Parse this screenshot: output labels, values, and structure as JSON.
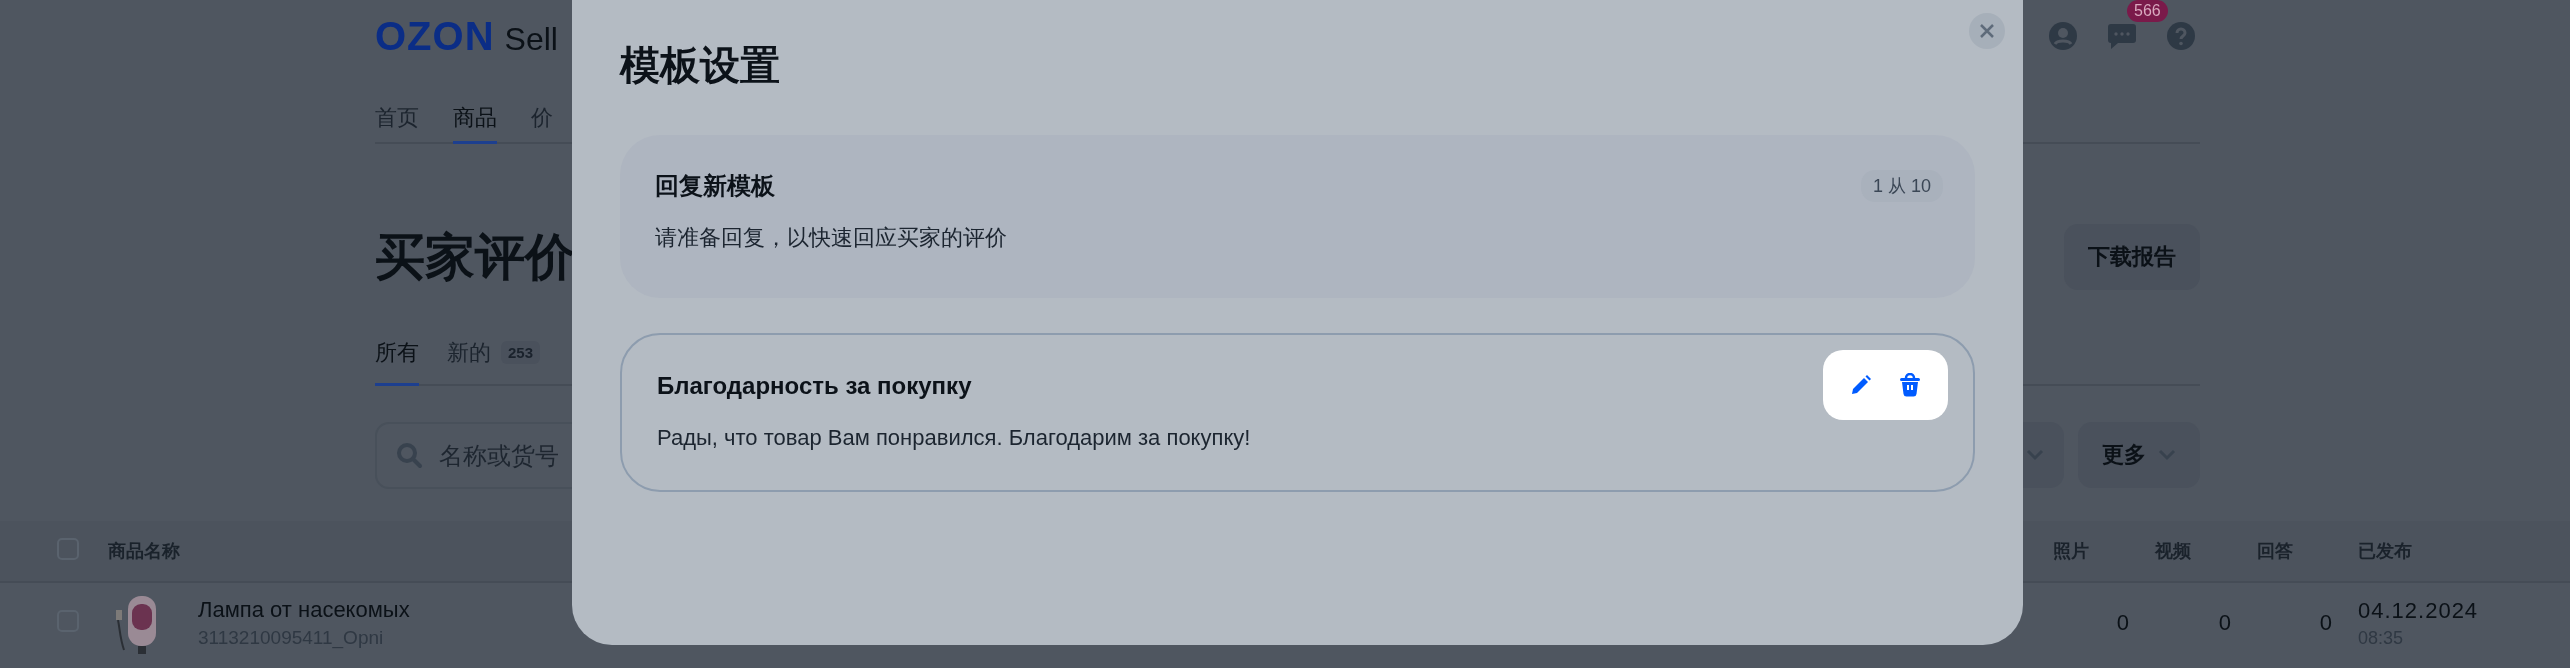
{
  "header": {
    "logo": "OZON",
    "logo_suffix": "Sell",
    "notifications_badge": "566"
  },
  "nav": [
    {
      "label": "首页",
      "selected": false
    },
    {
      "label": "商品",
      "selected": true
    },
    {
      "label": "价",
      "selected": false
    }
  ],
  "page_title": "买家评价",
  "download_button": "下载报告",
  "tabs": [
    {
      "label": "所有",
      "selected": true
    },
    {
      "label": "新的",
      "selected": false,
      "count": "253"
    }
  ],
  "search": {
    "placeholder": "名称或货号"
  },
  "more_button": "更多",
  "table": {
    "select_all_checked": false,
    "columns": [
      "商品名称",
      "照片",
      "视频",
      "回答",
      "已发布"
    ],
    "rows": [
      {
        "checked": false,
        "name": "Лампа от насекомых",
        "sku": "3113210095411_Opni",
        "photos": "0",
        "videos": "0",
        "answers": "0",
        "date": "04.12.2024",
        "time": "08:35"
      }
    ]
  },
  "modal": {
    "title": "模板设置",
    "new_template": {
      "title": "回复新模板",
      "description": "请准备回复，以快速回应买家的评价",
      "counter": "1 从 10"
    },
    "templates": [
      {
        "title": "Благодарность за покупку",
        "text": "Рады, что товар Вам понравился. Благодарим за покупку!"
      }
    ]
  }
}
